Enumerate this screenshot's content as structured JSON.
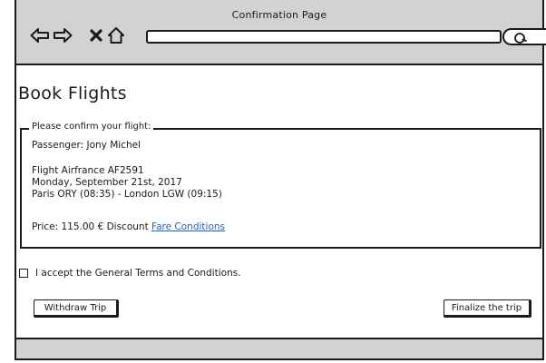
{
  "window": {
    "title": "Confirmation Page"
  },
  "toolbar": {
    "icons": [
      "back-arrow-icon",
      "forward-arrow-icon",
      "close-x-icon",
      "home-icon",
      "search-icon"
    ],
    "address_value": ""
  },
  "page": {
    "title": "Book Flights"
  },
  "confirmation": {
    "legend": "Please confirm your flight:",
    "passenger": "Passenger: Jony Michel",
    "flight": "Flight Airfrance AF2591",
    "date": "Monday, September 21st, 2017",
    "route": "Paris ORY (08:35) - London LGW (09:15)",
    "price": "Price: 115.00 € Discount",
    "fare_conditions_link": "Fare Conditions"
  },
  "terms": {
    "label": "I accept the General Terms and Conditions.",
    "checked": false
  },
  "actions": {
    "withdraw_label": "Withdraw Trip",
    "finalize_label": "Finalize the trip"
  },
  "colors": {
    "chrome": "#d2d2d2",
    "link": "#1f5fc7",
    "ink": "#1a1a1a"
  }
}
